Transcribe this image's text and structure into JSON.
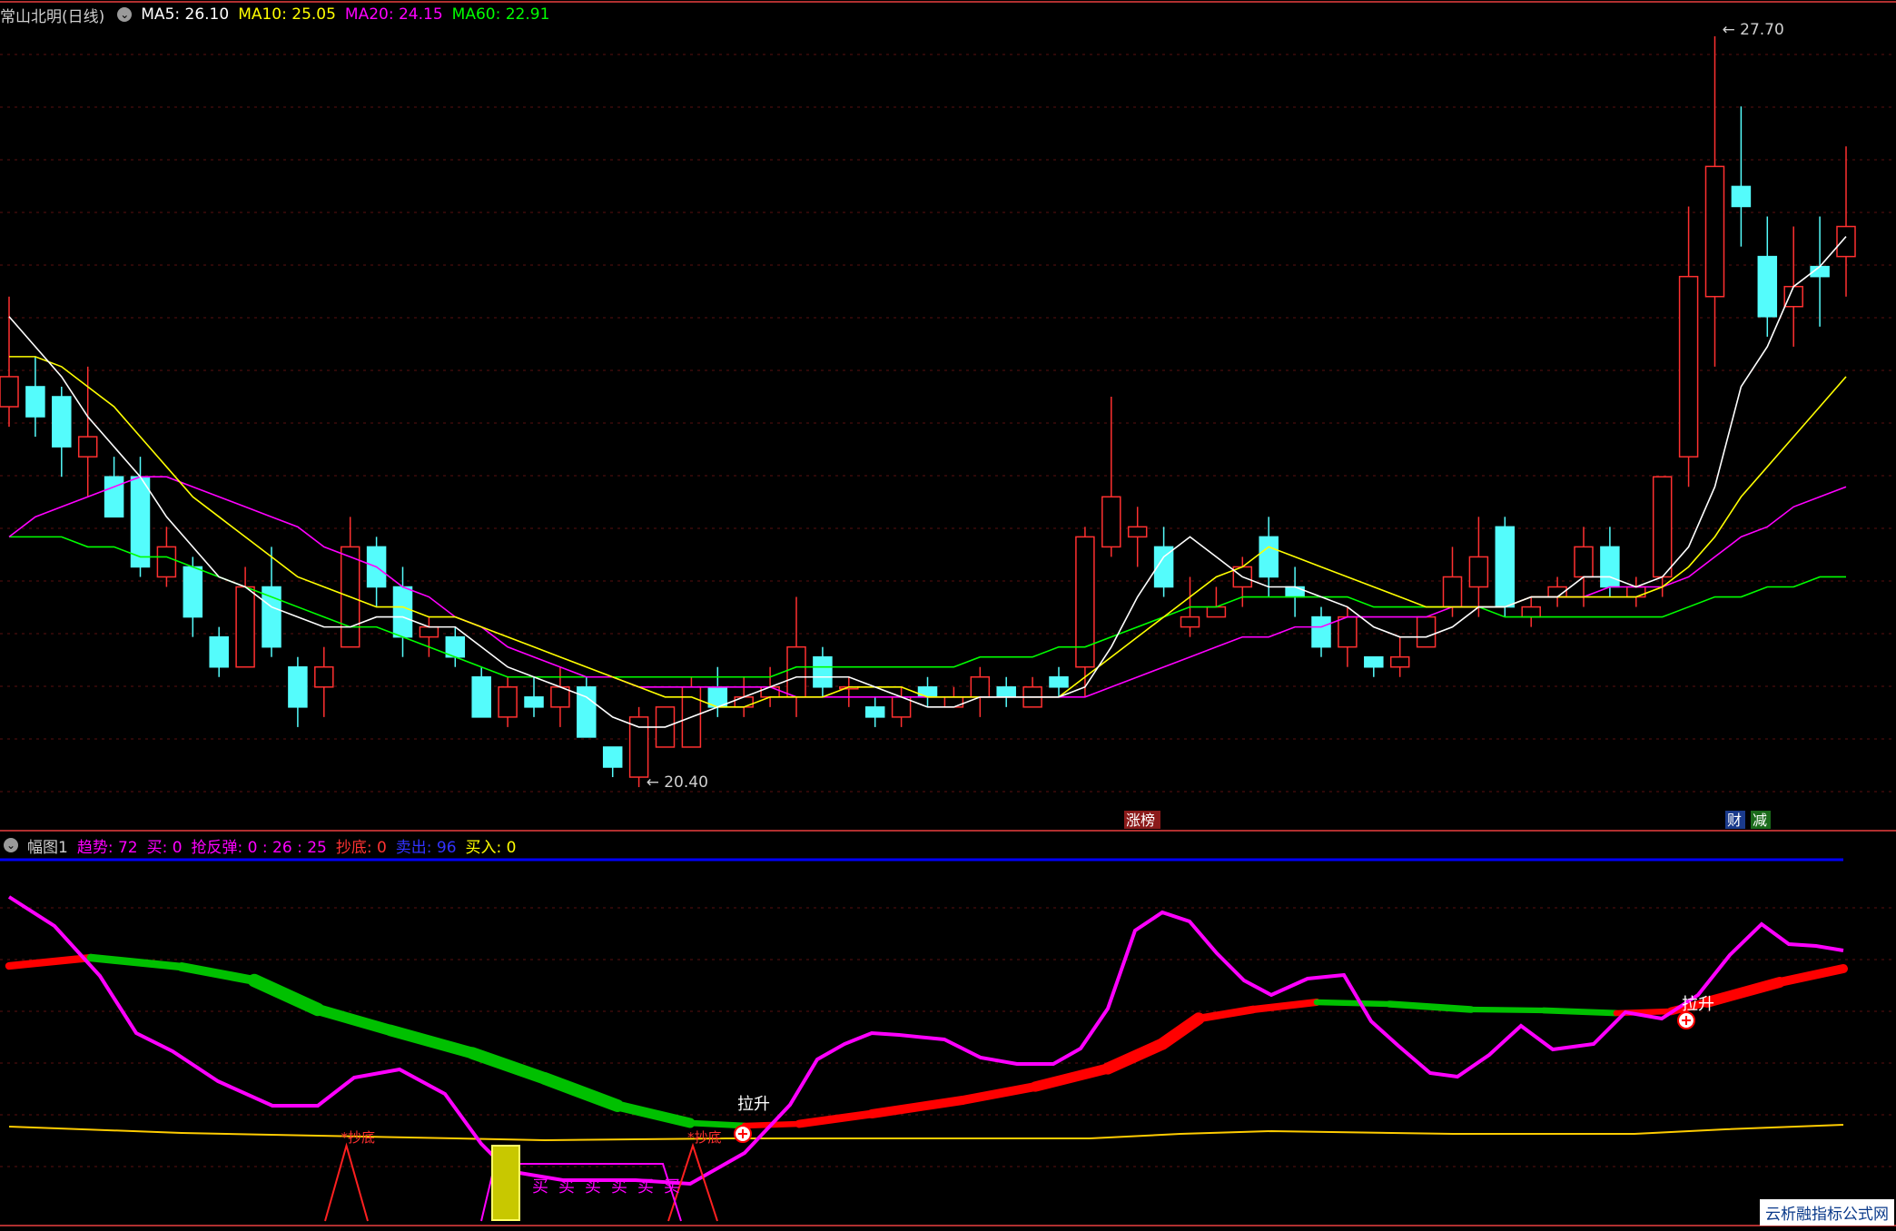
{
  "main_legend": {
    "title": "常山北明(日线)",
    "ma5": "MA5: 26.10",
    "ma10": "MA10: 25.05",
    "ma20": "MA20: 24.15",
    "ma60": "MA60: 22.91"
  },
  "price_labels": {
    "high": "27.70",
    "low": "20.40"
  },
  "event_labels": [
    "涨榜",
    "财",
    "减"
  ],
  "sub_legend": {
    "title": "幅图1",
    "items": [
      {
        "text": "趋势: 72",
        "color": "#ff00ff"
      },
      {
        "text": "买: 0",
        "color": "#ff00ff"
      },
      {
        "text": "抢反弹: 0 : 26 : 25",
        "color": "#ff00ff"
      },
      {
        "text": "抄底: 0",
        "color": "#ff3333"
      },
      {
        "text": "卖出: 96",
        "color": "#3333ff"
      },
      {
        "text": "买入: 0",
        "color": "#ffff00"
      }
    ]
  },
  "signal_labels": {
    "pull_up": "拉升",
    "bottom": "抄底",
    "buy": "买"
  },
  "watermark": "云析融指标公式网",
  "colors": {
    "up": "#ff3030",
    "down": "#54fcfc",
    "ma5": "#ffffff",
    "ma10": "#ffff00",
    "ma20": "#ff00ff",
    "ma60": "#00ff00"
  },
  "chart_data": {
    "type": "candlestick",
    "y_high": 27.7,
    "y_low": 20.4,
    "candles": [
      [
        24.0,
        24.3,
        25.1,
        23.8
      ],
      [
        24.2,
        23.9,
        24.5,
        23.7
      ],
      [
        24.1,
        23.6,
        24.2,
        23.3
      ],
      [
        23.5,
        23.7,
        24.4,
        23.1
      ],
      [
        23.3,
        22.9,
        23.5,
        22.9
      ],
      [
        23.3,
        22.4,
        23.5,
        22.3
      ],
      [
        22.3,
        22.6,
        22.8,
        22.2
      ],
      [
        22.4,
        21.9,
        22.5,
        21.7
      ],
      [
        21.7,
        21.4,
        21.8,
        21.3
      ],
      [
        21.4,
        22.2,
        22.4,
        21.4
      ],
      [
        22.2,
        21.6,
        22.6,
        21.5
      ],
      [
        21.4,
        21.0,
        21.5,
        20.8
      ],
      [
        21.2,
        21.4,
        21.6,
        20.9
      ],
      [
        21.6,
        22.6,
        22.9,
        21.6
      ],
      [
        22.6,
        22.2,
        22.7,
        22.0
      ],
      [
        22.2,
        21.7,
        22.4,
        21.5
      ],
      [
        21.7,
        21.8,
        21.9,
        21.5
      ],
      [
        21.7,
        21.5,
        21.8,
        21.4
      ],
      [
        21.3,
        20.9,
        21.4,
        20.9
      ],
      [
        20.9,
        21.2,
        21.3,
        20.8
      ],
      [
        21.1,
        21.0,
        21.3,
        20.9
      ],
      [
        21.0,
        21.2,
        21.4,
        20.8
      ],
      [
        21.2,
        20.7,
        21.3,
        20.7
      ],
      [
        20.6,
        20.4,
        20.6,
        20.3
      ],
      [
        20.3,
        20.9,
        21.0,
        20.2
      ],
      [
        20.6,
        21.0,
        21.0,
        20.6
      ],
      [
        20.6,
        21.2,
        21.3,
        20.6
      ],
      [
        21.2,
        21.0,
        21.4,
        20.9
      ],
      [
        21.0,
        21.1,
        21.3,
        20.9
      ],
      [
        21.1,
        21.2,
        21.4,
        21.0
      ],
      [
        21.1,
        21.6,
        22.1,
        20.9
      ],
      [
        21.5,
        21.2,
        21.6,
        21.1
      ],
      [
        21.2,
        21.2,
        21.3,
        21.0
      ],
      [
        21.0,
        20.9,
        21.1,
        20.8
      ],
      [
        20.9,
        21.1,
        21.2,
        20.8
      ],
      [
        21.2,
        21.1,
        21.3,
        21.0
      ],
      [
        21.0,
        21.1,
        21.2,
        21.0
      ],
      [
        21.1,
        21.3,
        21.4,
        20.9
      ],
      [
        21.2,
        21.1,
        21.3,
        21.0
      ],
      [
        21.0,
        21.2,
        21.3,
        21.0
      ],
      [
        21.3,
        21.2,
        21.4,
        21.1
      ],
      [
        21.4,
        22.7,
        22.8,
        21.1
      ],
      [
        22.6,
        23.1,
        24.1,
        22.5
      ],
      [
        22.7,
        22.8,
        23.0,
        22.4
      ],
      [
        22.6,
        22.2,
        22.8,
        22.1
      ],
      [
        21.8,
        21.9,
        22.3,
        21.7
      ],
      [
        21.9,
        22.0,
        22.2,
        21.9
      ],
      [
        22.2,
        22.4,
        22.5,
        22.0
      ],
      [
        22.7,
        22.3,
        22.9,
        22.1
      ],
      [
        22.2,
        22.1,
        22.4,
        21.9
      ],
      [
        21.9,
        21.6,
        22.0,
        21.5
      ],
      [
        21.6,
        21.9,
        22.0,
        21.4
      ],
      [
        21.5,
        21.4,
        21.5,
        21.3
      ],
      [
        21.4,
        21.5,
        21.7,
        21.3
      ],
      [
        21.6,
        21.9,
        21.9,
        21.6
      ],
      [
        22.0,
        22.3,
        22.6,
        21.9
      ],
      [
        22.2,
        22.5,
        22.9,
        21.9
      ],
      [
        22.8,
        22.0,
        22.9,
        21.9
      ],
      [
        21.9,
        22.0,
        22.1,
        21.8
      ],
      [
        22.1,
        22.2,
        22.3,
        22.0
      ],
      [
        22.3,
        22.6,
        22.8,
        22.0
      ],
      [
        22.6,
        22.2,
        22.8,
        22.1
      ],
      [
        22.1,
        22.2,
        22.3,
        22.0
      ],
      [
        22.3,
        23.3,
        23.3,
        22.1
      ],
      [
        23.5,
        25.3,
        26.0,
        23.2
      ],
      [
        25.1,
        26.4,
        27.7,
        24.4
      ],
      [
        26.2,
        26.0,
        27.0,
        25.6
      ],
      [
        25.5,
        24.9,
        25.9,
        24.7
      ],
      [
        25.0,
        25.2,
        25.8,
        24.6
      ],
      [
        25.4,
        25.3,
        25.9,
        24.8
      ],
      [
        25.5,
        25.8,
        26.6,
        25.1
      ]
    ],
    "ma5": [
      24.9,
      24.6,
      24.3,
      23.9,
      23.6,
      23.3,
      22.9,
      22.6,
      22.3,
      22.2,
      22.0,
      21.9,
      21.8,
      21.8,
      21.9,
      21.9,
      21.8,
      21.8,
      21.6,
      21.4,
      21.3,
      21.2,
      21.1,
      20.9,
      20.8,
      20.8,
      20.9,
      21.0,
      21.1,
      21.2,
      21.3,
      21.3,
      21.3,
      21.2,
      21.1,
      21.0,
      21.0,
      21.1,
      21.1,
      21.1,
      21.1,
      21.2,
      21.6,
      22.1,
      22.5,
      22.7,
      22.5,
      22.3,
      22.2,
      22.2,
      22.1,
      22.0,
      21.8,
      21.7,
      21.7,
      21.8,
      22.0,
      22.0,
      22.1,
      22.1,
      22.3,
      22.3,
      22.2,
      22.3,
      22.6,
      23.2,
      24.2,
      24.6,
      25.2,
      25.4,
      25.7
    ],
    "ma10": [
      24.5,
      24.5,
      24.4,
      24.2,
      24.0,
      23.7,
      23.4,
      23.1,
      22.9,
      22.7,
      22.5,
      22.3,
      22.2,
      22.1,
      22.0,
      22.0,
      21.9,
      21.9,
      21.8,
      21.7,
      21.6,
      21.5,
      21.4,
      21.3,
      21.2,
      21.1,
      21.1,
      21.0,
      21.0,
      21.1,
      21.1,
      21.1,
      21.2,
      21.2,
      21.2,
      21.1,
      21.1,
      21.1,
      21.1,
      21.1,
      21.1,
      21.3,
      21.5,
      21.7,
      21.9,
      22.1,
      22.3,
      22.4,
      22.6,
      22.5,
      22.4,
      22.3,
      22.2,
      22.1,
      22.0,
      22.0,
      22.0,
      22.0,
      22.1,
      22.1,
      22.1,
      22.1,
      22.1,
      22.2,
      22.4,
      22.7,
      23.1,
      23.4,
      23.7,
      24.0,
      24.3
    ],
    "ma20": [
      22.7,
      22.9,
      23.0,
      23.1,
      23.2,
      23.3,
      23.3,
      23.2,
      23.1,
      23.0,
      22.9,
      22.8,
      22.6,
      22.5,
      22.4,
      22.2,
      22.1,
      21.9,
      21.8,
      21.6,
      21.5,
      21.4,
      21.3,
      21.3,
      21.2,
      21.2,
      21.2,
      21.2,
      21.2,
      21.2,
      21.1,
      21.1,
      21.1,
      21.1,
      21.1,
      21.1,
      21.1,
      21.1,
      21.1,
      21.1,
      21.1,
      21.1,
      21.2,
      21.3,
      21.4,
      21.5,
      21.6,
      21.7,
      21.7,
      21.8,
      21.8,
      21.9,
      21.9,
      21.9,
      21.9,
      22.0,
      22.0,
      22.0,
      22.1,
      22.1,
      22.1,
      22.2,
      22.2,
      22.2,
      22.3,
      22.5,
      22.7,
      22.8,
      23.0,
      23.1,
      23.2
    ],
    "ma60": [
      22.7,
      22.7,
      22.7,
      22.6,
      22.6,
      22.5,
      22.5,
      22.4,
      22.3,
      22.2,
      22.1,
      22.0,
      21.9,
      21.8,
      21.8,
      21.7,
      21.6,
      21.5,
      21.4,
      21.3,
      21.3,
      21.3,
      21.3,
      21.3,
      21.3,
      21.3,
      21.3,
      21.3,
      21.3,
      21.3,
      21.4,
      21.4,
      21.4,
      21.4,
      21.4,
      21.4,
      21.4,
      21.5,
      21.5,
      21.5,
      21.6,
      21.6,
      21.7,
      21.8,
      21.9,
      22.0,
      22.0,
      22.1,
      22.1,
      22.1,
      22.1,
      22.1,
      22.0,
      22.0,
      22.0,
      22.0,
      22.0,
      21.9,
      21.9,
      21.9,
      21.9,
      21.9,
      21.9,
      21.9,
      22.0,
      22.1,
      22.1,
      22.2,
      22.2,
      22.3,
      22.3
    ]
  }
}
